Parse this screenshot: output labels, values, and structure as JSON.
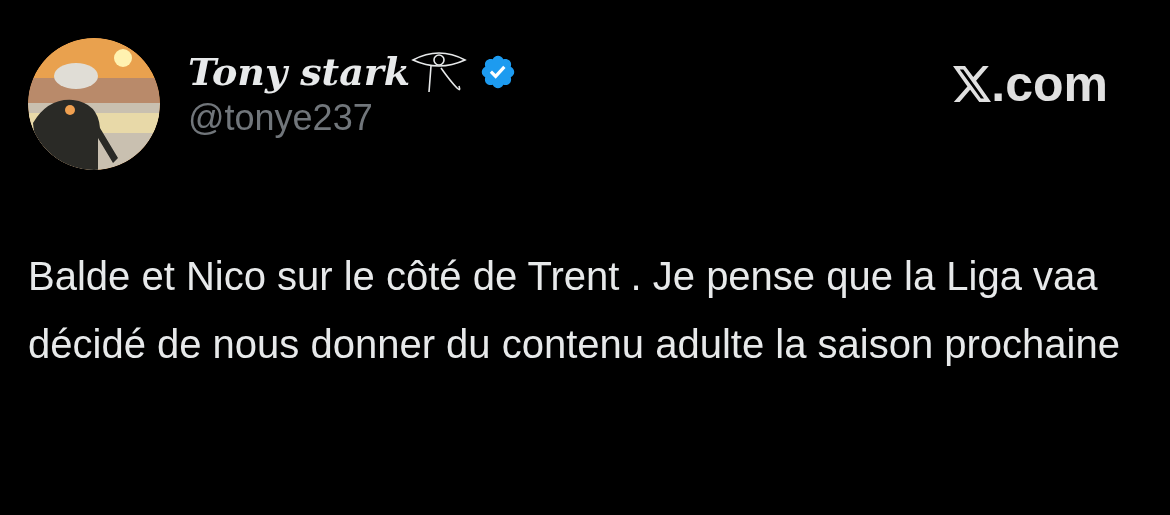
{
  "author": {
    "name": "Tony stark",
    "handle": "@tonye237",
    "verified": true
  },
  "brand": {
    "domain": ".com"
  },
  "tweet": {
    "text": "Balde et Nico sur le côté de Trent . Je pense que la Liga vaa décidé de nous donner du contenu adulte la saison prochaine"
  }
}
